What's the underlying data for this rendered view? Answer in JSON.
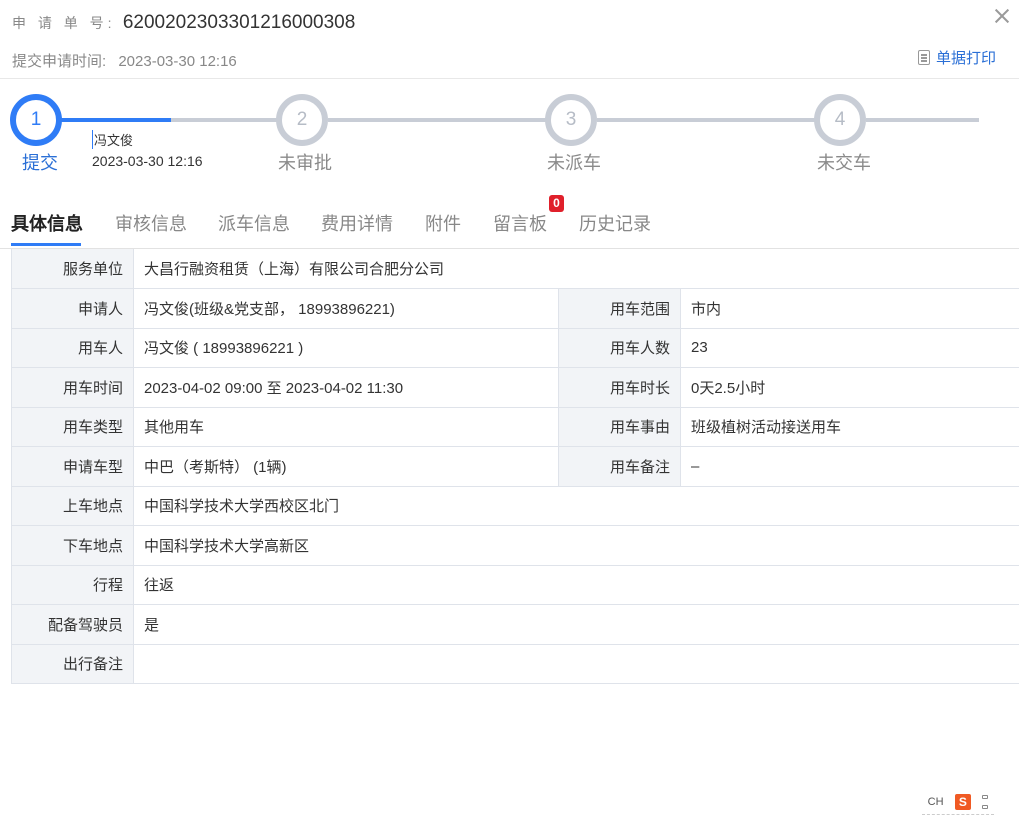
{
  "header": {
    "order_label": "申 请 单 号:",
    "order_number": "6200202303301216000308",
    "submit_time_label": "提交申请时间:",
    "submit_time": "2023-03-30 12:16",
    "print_label": "单据打印"
  },
  "steps": [
    {
      "number": "1",
      "label": "提交",
      "person": "冯文俊",
      "time": "2023-03-30 12:16"
    },
    {
      "number": "2",
      "label": "未审批"
    },
    {
      "number": "3",
      "label": "未派车"
    },
    {
      "number": "4",
      "label": "未交车"
    }
  ],
  "tabs": [
    {
      "label": "具体信息"
    },
    {
      "label": "审核信息"
    },
    {
      "label": "派车信息"
    },
    {
      "label": "费用详情"
    },
    {
      "label": "附件"
    },
    {
      "label": "留言板",
      "badge": "0"
    },
    {
      "label": "历史记录"
    }
  ],
  "info": {
    "service_unit": {
      "label": "服务单位",
      "value": "大昌行融资租赁（上海）有限公司合肥分公司"
    },
    "applicant": {
      "label": "申请人",
      "value": "冯文俊(班级&党支部， 18993896221)"
    },
    "scope": {
      "label": "用车范围",
      "value": "市内"
    },
    "user": {
      "label": "用车人",
      "value": "冯文俊 ( 18993896221 )"
    },
    "passengers": {
      "label": "用车人数",
      "value": "23"
    },
    "time": {
      "label": "用车时间",
      "value": "2023-04-02 09:00 至 2023-04-02 11:30"
    },
    "duration": {
      "label": "用车时长",
      "value": "0天2.5小时"
    },
    "type": {
      "label": "用车类型",
      "value": "其他用车"
    },
    "reason": {
      "label": "用车事由",
      "value": "班级植树活动接送用车"
    },
    "model": {
      "label": "申请车型",
      "value": "中巴（考斯特） (1辆)"
    },
    "remark": {
      "label": "用车备注",
      "value": "–"
    },
    "pickup": {
      "label": "上车地点",
      "value": "中国科学技术大学西校区北门"
    },
    "dropoff": {
      "label": "下车地点",
      "value": "中国科学技术大学高新区"
    },
    "trip": {
      "label": "行程",
      "value": "往返"
    },
    "driver": {
      "label": "配备驾驶员",
      "value": "是"
    },
    "travel_note": {
      "label": "出行备注",
      "value": ""
    }
  },
  "ime": {
    "lang": "CH",
    "logo": "S"
  },
  "colors": {
    "accent": "#2f7cf6",
    "badge": "#e0202b",
    "inactive_step": "#c8cdd6"
  }
}
